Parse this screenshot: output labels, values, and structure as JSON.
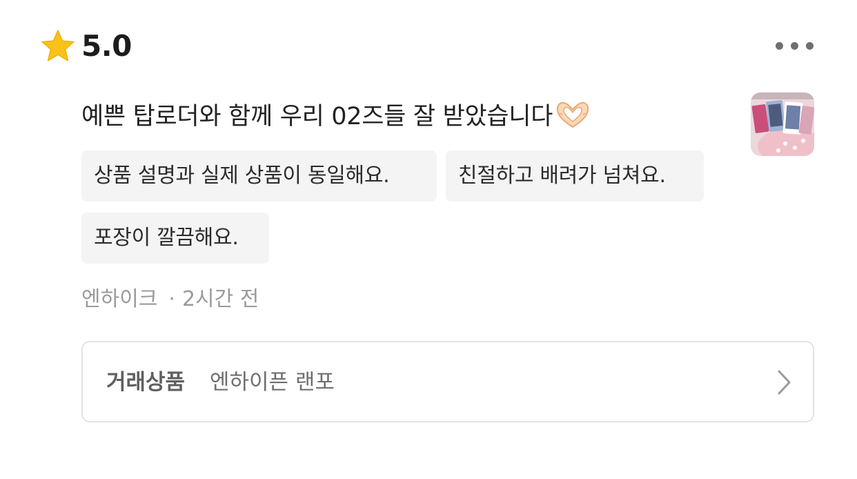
{
  "review": {
    "rating": "5.0",
    "text": "예쁜 탑로더와 함께 우리 02즈들 잘 받았습니다",
    "tags": [
      "상품 설명과 실제 상품이 동일해요.",
      "친절하고 배려가 넘쳐요.",
      "포장이 깔끔해요."
    ],
    "author": "엔하이크",
    "separator": "·",
    "time": "2시간 전"
  },
  "product": {
    "label": "거래상품",
    "name": "엔하이픈 랜포"
  },
  "icons": {
    "rating": "star-icon",
    "menu": "more-icon",
    "emoji": "heart-hands-icon",
    "link": "chevron-right-icon"
  },
  "colors": {
    "star": "#f9c21b",
    "tag_background": "#f4f4f5",
    "muted_text": "#9a9a9a",
    "border": "#e3e3e3"
  }
}
